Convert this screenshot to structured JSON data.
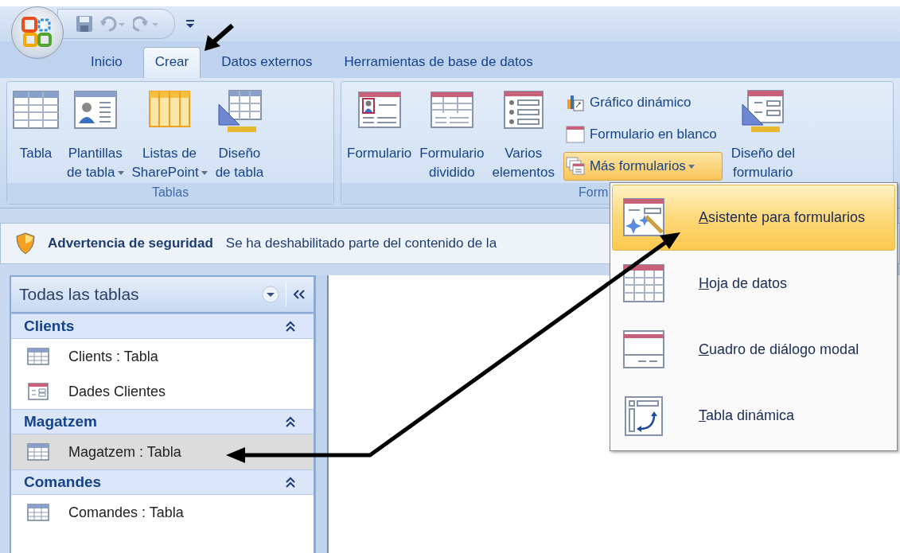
{
  "tabs": [
    {
      "label": "Inicio",
      "selected": false
    },
    {
      "label": "Crear",
      "selected": true
    },
    {
      "label": "Datos externos",
      "selected": false
    },
    {
      "label": "Herramientas de base de datos",
      "selected": false
    }
  ],
  "ribbon": {
    "groups": [
      {
        "label": "Tablas",
        "columns": [
          {
            "kind": "large",
            "items": [
              {
                "lines": [
                  "Tabla"
                ],
                "dropdown": false
              }
            ]
          },
          {
            "kind": "large",
            "items": [
              {
                "lines": [
                  "Plantillas",
                  "de tabla"
                ],
                "dropdown": true
              }
            ]
          },
          {
            "kind": "large",
            "items": [
              {
                "lines": [
                  "Listas de",
                  "SharePoint"
                ],
                "dropdown": true
              }
            ]
          },
          {
            "kind": "large",
            "items": [
              {
                "lines": [
                  "Diseño",
                  "de tabla"
                ],
                "dropdown": false
              }
            ]
          }
        ]
      },
      {
        "label": "Form",
        "columns": [
          {
            "kind": "large",
            "items": [
              {
                "lines": [
                  "Formulario"
                ],
                "dropdown": false
              }
            ]
          },
          {
            "kind": "large",
            "items": [
              {
                "lines": [
                  "Formulario",
                  "dividido"
                ],
                "dropdown": false
              }
            ]
          },
          {
            "kind": "large",
            "items": [
              {
                "lines": [
                  "Varios",
                  "elementos"
                ],
                "dropdown": false
              }
            ]
          },
          {
            "kind": "small",
            "items": [
              {
                "lines": [
                  "Gráfico dinámico"
                ],
                "dropdown": false,
                "selected": false
              },
              {
                "lines": [
                  "Formulario en blanco"
                ],
                "dropdown": false,
                "selected": false
              },
              {
                "lines": [
                  "Más formularios"
                ],
                "dropdown": true,
                "selected": true
              }
            ]
          },
          {
            "kind": "large",
            "items": [
              {
                "lines": [
                  "Diseño del",
                  "formulario"
                ],
                "dropdown": false
              }
            ]
          }
        ]
      }
    ]
  },
  "security_bar": {
    "title": "Advertencia de seguridad",
    "message": "Se ha deshabilitado parte del contenido de la"
  },
  "nav_pane": {
    "title": "Todas las tablas",
    "groups": [
      {
        "label": "Clients",
        "expanded": true,
        "items": [
          {
            "label": "Clients : Tabla",
            "kind": "table",
            "selected": false
          },
          {
            "label": "Dades Clientes",
            "kind": "form",
            "selected": false
          }
        ]
      },
      {
        "label": "Magatzem",
        "expanded": true,
        "items": [
          {
            "label": "Magatzem : Tabla",
            "kind": "table",
            "selected": true
          }
        ]
      },
      {
        "label": "Comandes",
        "expanded": true,
        "items": [
          {
            "label": "Comandes : Tabla",
            "kind": "table",
            "selected": false
          }
        ]
      }
    ]
  },
  "menu": {
    "items": [
      {
        "label": "Asistente para formularios",
        "selected": true
      },
      {
        "label": "Hoja de datos",
        "selected": false
      },
      {
        "label": "Cuadro de diálogo modal",
        "selected": false
      },
      {
        "label": "Tabla dinámica",
        "selected": false
      }
    ]
  }
}
